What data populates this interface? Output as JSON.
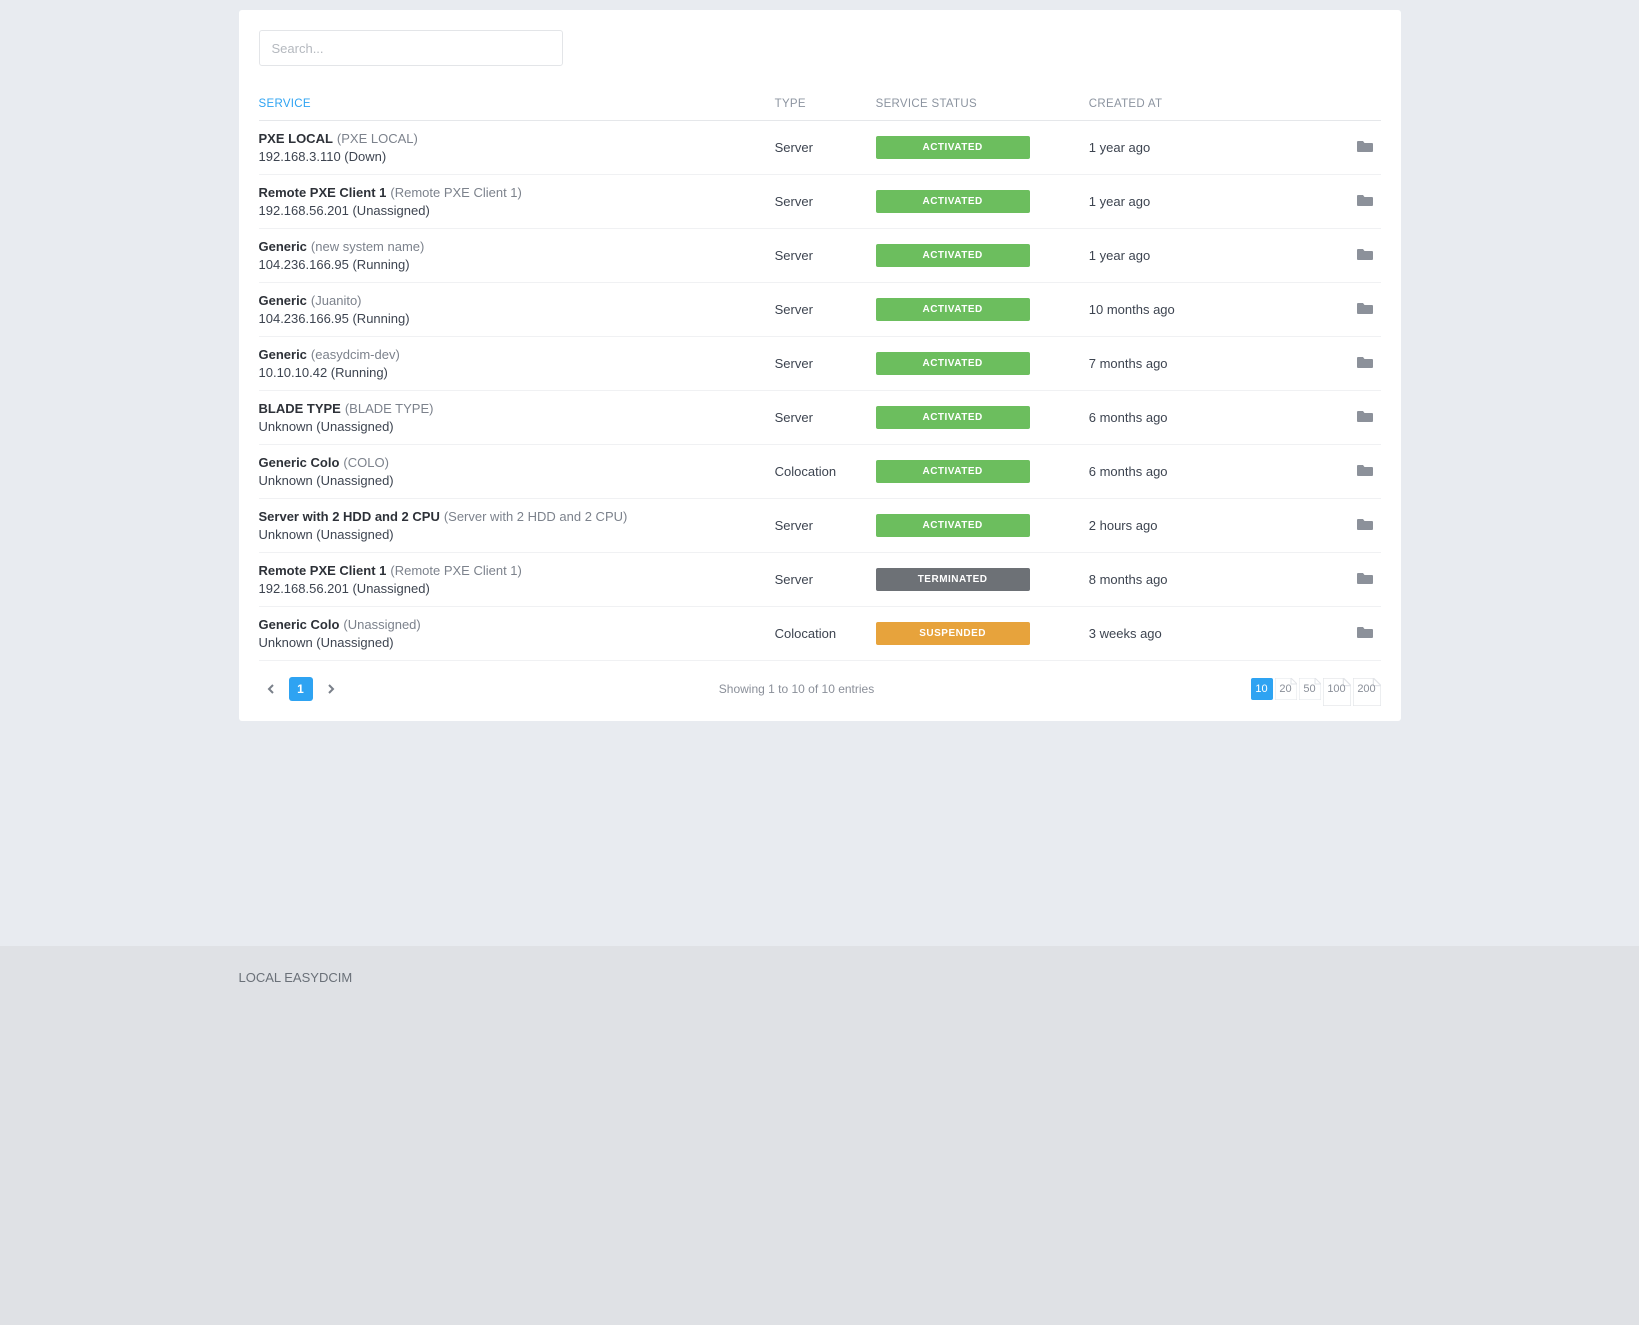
{
  "search": {
    "placeholder": "Search..."
  },
  "columns": {
    "service": "SERVICE",
    "type": "TYPE",
    "status": "SERVICE STATUS",
    "created": "CREATED AT"
  },
  "rows": [
    {
      "name": "PXE LOCAL",
      "sub": "(PXE LOCAL)",
      "line2": "192.168.3.110 (Down)",
      "type": "Server",
      "status": "ACTIVATED",
      "created": "1 year ago"
    },
    {
      "name": "Remote PXE Client 1",
      "sub": "(Remote PXE Client 1)",
      "line2": "192.168.56.201 (Unassigned)",
      "type": "Server",
      "status": "ACTIVATED",
      "created": "1 year ago"
    },
    {
      "name": "Generic",
      "sub": "(new system name)",
      "line2": "104.236.166.95 (Running)",
      "type": "Server",
      "status": "ACTIVATED",
      "created": "1 year ago"
    },
    {
      "name": "Generic",
      "sub": "(Juanito)",
      "line2": "104.236.166.95 (Running)",
      "type": "Server",
      "status": "ACTIVATED",
      "created": "10 months ago"
    },
    {
      "name": "Generic",
      "sub": "(easydcim-dev)",
      "line2": "10.10.10.42 (Running)",
      "type": "Server",
      "status": "ACTIVATED",
      "created": "7 months ago"
    },
    {
      "name": "BLADE TYPE",
      "sub": "(BLADE TYPE)",
      "line2": "Unknown (Unassigned)",
      "type": "Server",
      "status": "ACTIVATED",
      "created": "6 months ago"
    },
    {
      "name": "Generic Colo",
      "sub": "(COLO)",
      "line2": "Unknown (Unassigned)",
      "type": "Colocation",
      "status": "ACTIVATED",
      "created": "6 months ago"
    },
    {
      "name": "Server with 2 HDD and 2 CPU",
      "sub": "(Server with 2 HDD and 2 CPU)",
      "line2": "Unknown (Unassigned)",
      "type": "Server",
      "status": "ACTIVATED",
      "created": "2 hours ago"
    },
    {
      "name": "Remote PXE Client 1",
      "sub": "(Remote PXE Client 1)",
      "line2": "192.168.56.201 (Unassigned)",
      "type": "Server",
      "status": "TERMINATED",
      "created": "8 months ago"
    },
    {
      "name": "Generic Colo",
      "sub": "(Unassigned)",
      "line2": "Unknown (Unassigned)",
      "type": "Colocation",
      "status": "SUSPENDED",
      "created": "3 weeks ago"
    }
  ],
  "pagination": {
    "current": "1",
    "summary": "Showing 1 to 10 of 10 entries",
    "sizes": [
      "10",
      "20",
      "50",
      "100",
      "200"
    ],
    "active_size": "10"
  },
  "footer": "LOCAL EASYDCIM"
}
